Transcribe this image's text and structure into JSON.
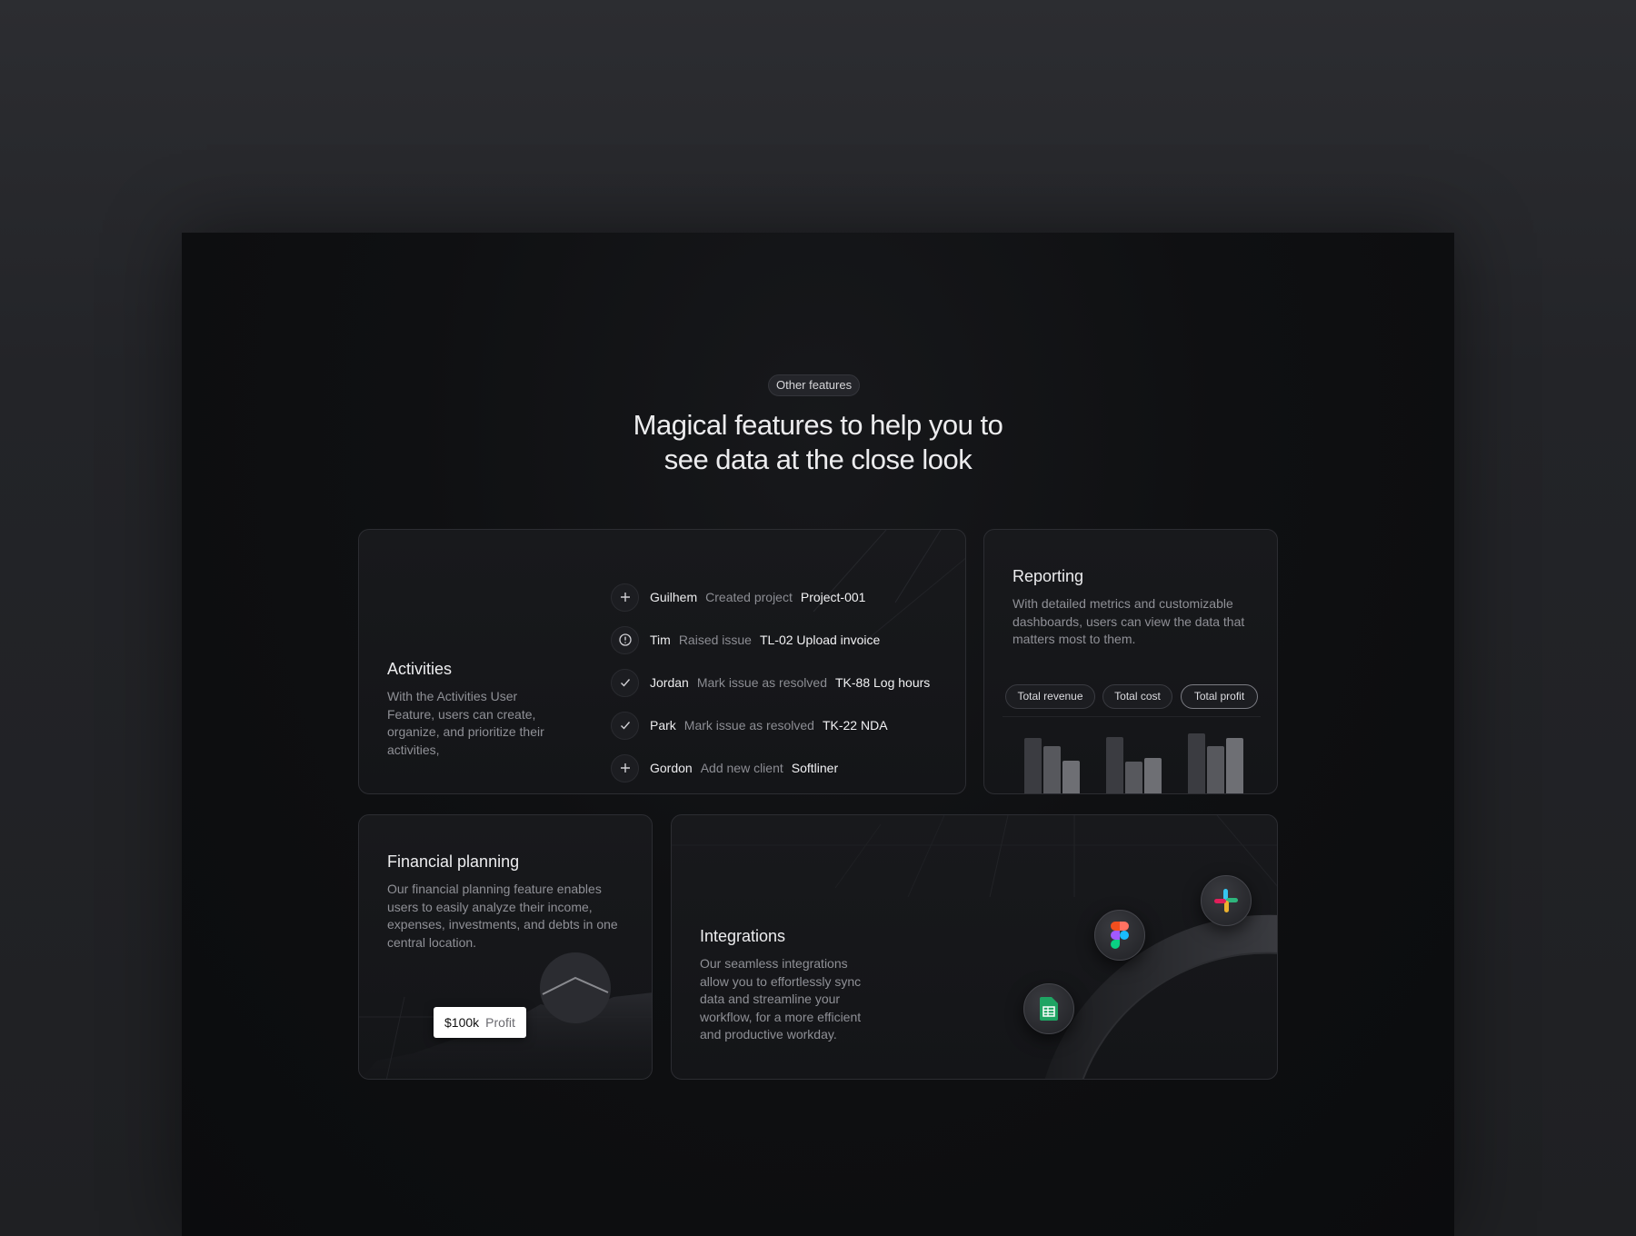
{
  "section": {
    "pill": "Other features",
    "headline_line1": "Magical features to help you to",
    "headline_line2": "see data at the close look"
  },
  "activities": {
    "title": "Activities",
    "description": "With the Activities User Feature, users can create, organize, and prioritize their activities,",
    "items": [
      {
        "icon": "plus-icon",
        "user": "Guilhem",
        "verb": "Created project",
        "object": "Project-001"
      },
      {
        "icon": "alert-circle-icon",
        "user": "Tim",
        "verb": "Raised issue",
        "object": "TL-02 Upload invoice"
      },
      {
        "icon": "check-icon",
        "user": "Jordan",
        "verb": "Mark issue as resolved",
        "object": "TK-88 Log hours"
      },
      {
        "icon": "check-icon",
        "user": "Park",
        "verb": "Mark issue as resolved",
        "object": "TK-22 NDA"
      },
      {
        "icon": "plus-icon",
        "user": "Gordon",
        "verb": "Add new client",
        "object": "Softliner"
      }
    ]
  },
  "reporting": {
    "title": "Reporting",
    "description": "With detailed metrics and customizable dashboards, users can view the data that matters most to them.",
    "tabs": [
      "Total revenue",
      "Total cost",
      "Total profit"
    ],
    "active_tab": "Total profit",
    "bar_groups": [
      [
        0.72,
        0.62,
        0.44
      ],
      [
        0.74,
        0.42,
        0.47
      ],
      [
        0.78,
        0.62,
        0.72
      ]
    ]
  },
  "financial": {
    "title": "Financial planning",
    "description": "Our financial planning feature enables users to easily analyze their income, expenses, investments, and debts in one central location.",
    "badge_value": "$100k",
    "badge_label": "Profit"
  },
  "integrations": {
    "title": "Integrations",
    "description": "Our seamless integrations allow you to effortlessly sync data and streamline your workflow, for a more efficient and productive workday.",
    "apps": [
      "google-sheets-icon",
      "figma-icon",
      "slack-icon"
    ]
  },
  "colors": {
    "sheets_green": "#1fa463",
    "figma_red": "#f24e1e",
    "figma_orange": "#ff7262",
    "figma_purple": "#a259ff",
    "figma_blue": "#1abcfe",
    "figma_green": "#0acf83",
    "slack_blue": "#36c5f0",
    "slack_green": "#2eb67d",
    "slack_yellow": "#ecb22e",
    "slack_red": "#e01e5a"
  }
}
